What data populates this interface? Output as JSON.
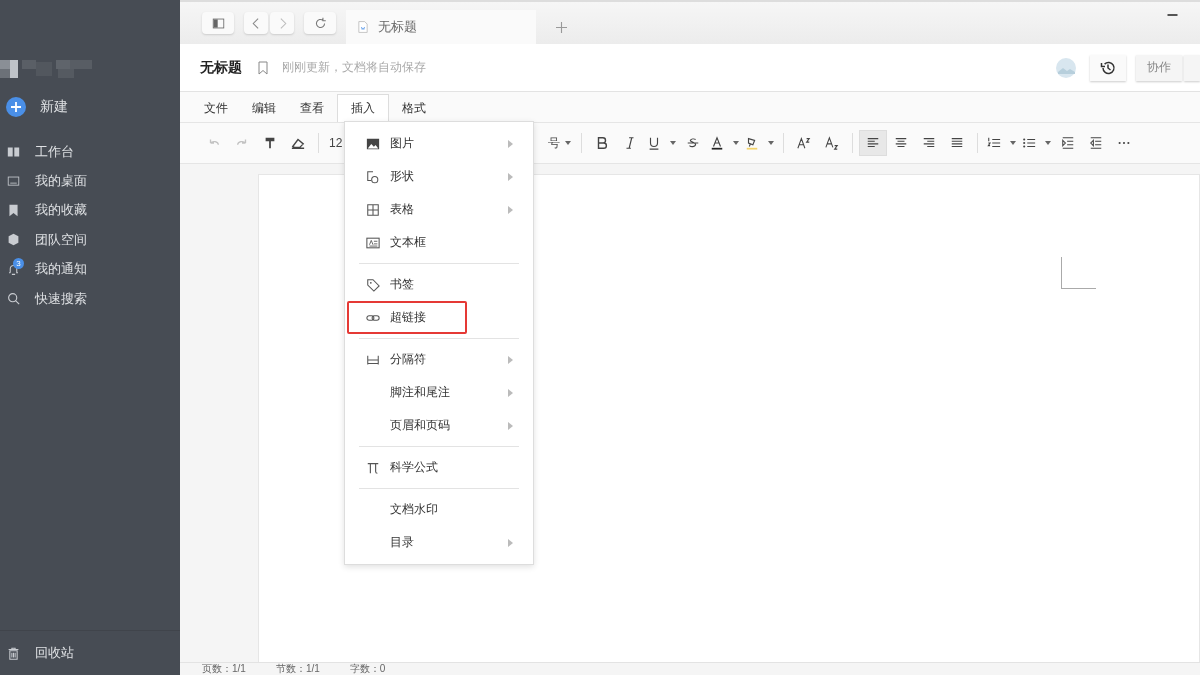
{
  "sidebar": {
    "new_button": "新建",
    "items": [
      {
        "label": "工作台"
      },
      {
        "label": "我的桌面"
      },
      {
        "label": "我的收藏"
      },
      {
        "label": "团队空间"
      },
      {
        "label": "我的通知",
        "badge": "3"
      },
      {
        "label": "快速搜索"
      }
    ],
    "trash": "回收站"
  },
  "browser_tab": {
    "title": "无标题"
  },
  "document": {
    "title": "无标题",
    "save_status": "刚刚更新，文档将自动保存",
    "collab_button": "协作"
  },
  "menu_bar": [
    {
      "label": "文件",
      "selected": false
    },
    {
      "label": "编辑",
      "selected": false
    },
    {
      "label": "查看",
      "selected": false
    },
    {
      "label": "插入",
      "selected": true
    },
    {
      "label": "格式",
      "selected": false
    }
  ],
  "toolbar": [
    {
      "kind": "icon",
      "disabled": true
    },
    {
      "kind": "icon",
      "disabled": true
    },
    {
      "kind": "icon",
      "disabled": false
    },
    {
      "kind": "icon",
      "disabled": false
    },
    {
      "kind": "sep"
    },
    {
      "kind": "text",
      "label": "12"
    },
    {
      "kind": "gap"
    },
    {
      "kind": "text",
      "label": "号",
      "dropdown": true
    },
    {
      "kind": "sep"
    },
    {
      "kind": "icon",
      "disabled": false
    },
    {
      "kind": "icon",
      "disabled": false
    },
    {
      "kind": "icon",
      "dropdown": true,
      "disabled": false
    },
    {
      "kind": "icon",
      "disabled": false
    },
    {
      "kind": "icon",
      "dropdown": true,
      "disabled": false
    },
    {
      "kind": "icon",
      "dropdown": true,
      "disabled": false
    },
    {
      "kind": "sep"
    },
    {
      "kind": "icon",
      "disabled": false
    },
    {
      "kind": "icon",
      "disabled": false
    },
    {
      "kind": "sep"
    },
    {
      "kind": "icon",
      "selected": true,
      "disabled": false
    },
    {
      "kind": "icon",
      "selected": false,
      "disabled": false
    },
    {
      "kind": "icon",
      "selected": false,
      "disabled": false
    },
    {
      "kind": "icon",
      "selected": false,
      "disabled": false
    },
    {
      "kind": "sep"
    },
    {
      "kind": "icon",
      "dropdown": true,
      "disabled": false
    },
    {
      "kind": "icon",
      "dropdown": true,
      "disabled": false
    },
    {
      "kind": "icon",
      "disabled": false
    },
    {
      "kind": "icon",
      "disabled": false
    },
    {
      "kind": "icon",
      "disabled": false
    }
  ],
  "insert_menu": [
    {
      "kind": "item",
      "label": "图片",
      "submenu": true,
      "highlighted": false
    },
    {
      "kind": "item",
      "label": "形状",
      "submenu": true,
      "highlighted": false
    },
    {
      "kind": "item",
      "label": "表格",
      "submenu": true,
      "highlighted": false
    },
    {
      "kind": "item",
      "label": "文本框",
      "submenu": false,
      "highlighted": false
    },
    {
      "kind": "divider"
    },
    {
      "kind": "item",
      "label": "书签",
      "submenu": false,
      "highlighted": false
    },
    {
      "kind": "item",
      "label": "超链接",
      "submenu": false,
      "highlighted": true
    },
    {
      "kind": "divider"
    },
    {
      "kind": "item",
      "label": "分隔符",
      "submenu": true,
      "highlighted": false
    },
    {
      "kind": "item",
      "label": "脚注和尾注",
      "submenu": true,
      "highlighted": false
    },
    {
      "kind": "item",
      "label": "页眉和页码",
      "submenu": true,
      "highlighted": false
    },
    {
      "kind": "divider"
    },
    {
      "kind": "item",
      "label": "科学公式",
      "submenu": false,
      "highlighted": false
    },
    {
      "kind": "divider"
    },
    {
      "kind": "item",
      "label": "文档水印",
      "submenu": false,
      "highlighted": false
    },
    {
      "kind": "item",
      "label": "目录",
      "submenu": true,
      "highlighted": false
    }
  ],
  "status_bar": [
    "页数：1/1",
    "节数：1/1",
    "字数：0"
  ]
}
